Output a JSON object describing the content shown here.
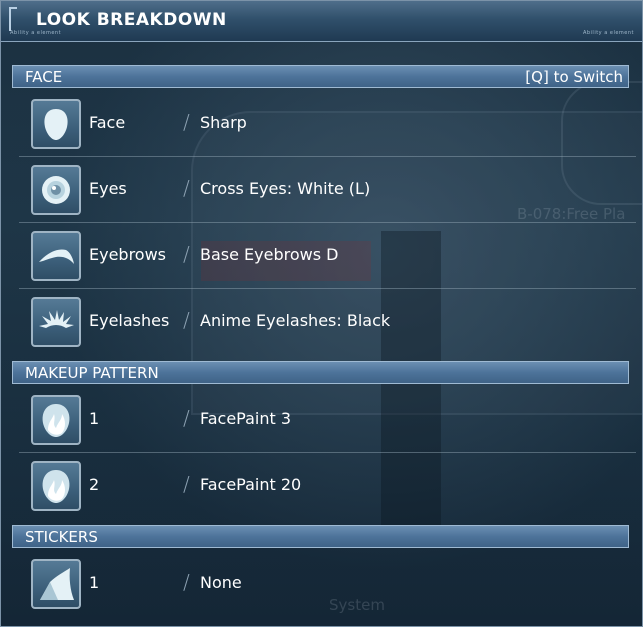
{
  "window": {
    "title": "LOOK BREAKDOWN",
    "tiny_left": "Ability a element",
    "tiny_right": "Ability a element"
  },
  "background": {
    "sign_text": "B-078:Free Pla",
    "system_text": "System"
  },
  "sections": {
    "face": {
      "label": "FACE",
      "hint": "[Q] to Switch",
      "rows": [
        {
          "icon": "face-shape-icon",
          "label": "Face",
          "value": "Sharp"
        },
        {
          "icon": "eye-icon",
          "label": "Eyes",
          "value": "Cross Eyes: White (L)"
        },
        {
          "icon": "eyebrow-icon",
          "label": "Eyebrows",
          "value": "Base Eyebrows D"
        },
        {
          "icon": "eyelashes-icon",
          "label": "Eyelashes",
          "value": "Anime Eyelashes: Black"
        }
      ]
    },
    "makeup": {
      "label": "MAKEUP PATTERN",
      "rows": [
        {
          "icon": "face-paint-icon",
          "label": "1",
          "value": "FacePaint 3"
        },
        {
          "icon": "face-paint-icon",
          "label": "2",
          "value": "FacePaint 20"
        }
      ]
    },
    "stickers": {
      "label": "STICKERS",
      "rows": [
        {
          "icon": "sticker-icon",
          "label": "1",
          "value": "None"
        }
      ]
    }
  },
  "colors": {
    "panel_bg": "#1d3344",
    "section_bar": "#4d739a",
    "icon_fill": "#e4f1f6"
  }
}
